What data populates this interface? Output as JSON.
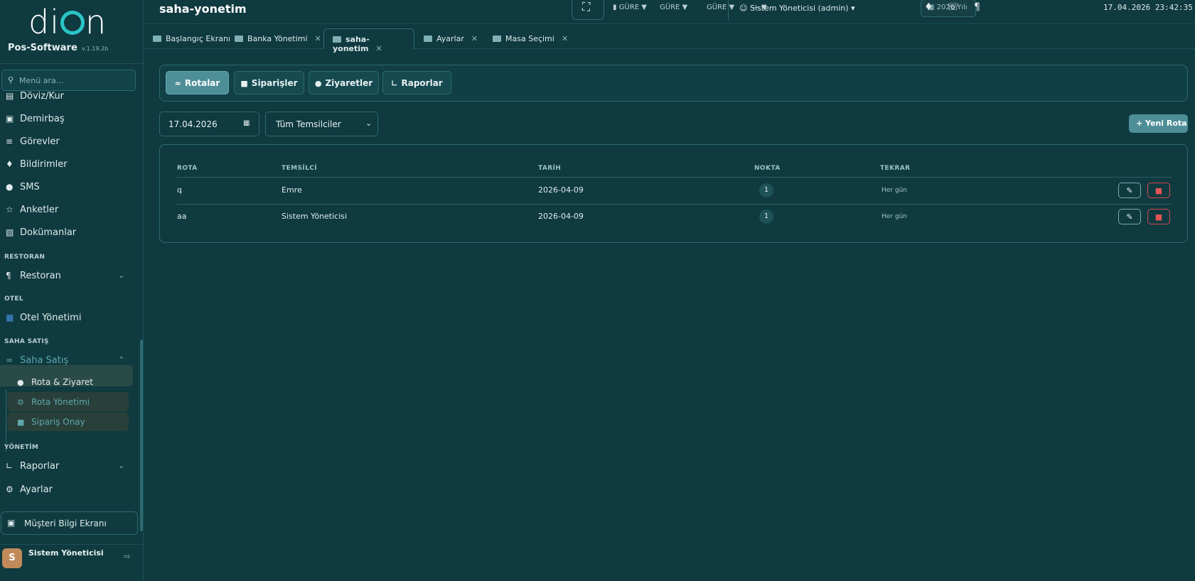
{
  "brand": {
    "logo_text_left": "di",
    "logo_text_right": "n",
    "product": "Pos-Software",
    "version": "v.1.19.2b"
  },
  "sidebar": {
    "search_placeholder": "Menü ara...",
    "items": [
      {
        "label": "Döviz/Kur",
        "icon": "money-icon"
      },
      {
        "label": "Demirbaş",
        "icon": "monitor-icon"
      },
      {
        "label": "Görevler",
        "icon": "tasks-icon"
      },
      {
        "label": "Bildirimler",
        "icon": "bell-icon"
      },
      {
        "label": "SMS",
        "icon": "chat-icon"
      },
      {
        "label": "Anketler",
        "icon": "star-icon"
      },
      {
        "label": "Dokümanlar",
        "icon": "folder-icon"
      }
    ],
    "section_restoran": "RESTORAN",
    "restoran": "Restoran",
    "section_otel": "OTEL",
    "otel": "Otel Yönetimi",
    "section_saha": "SAHA SATIŞ",
    "saha": "Saha Satış",
    "saha_sub": [
      "Rota & Ziyaret",
      "Rota Yönetimi",
      "Sipariş Onay"
    ],
    "section_yonetim": "YÖNETİM",
    "raporlar": "Raporlar",
    "ayarlar": "Ayarlar",
    "musteri": "Müşteri Bilgi Ekranı",
    "user_initial": "S",
    "user_name": "Sistem Yöneticisi"
  },
  "topbar": {
    "title": "saha-yonetim",
    "gure1": "GÜRE",
    "gure2": "GÜRE",
    "gure3": "GÜRE",
    "dash": "—",
    "user": "Sistem Yöneticisi (admin)",
    "year": "2026 Yılı",
    "datetime": "17.04.2026 23:42:35"
  },
  "tabs": [
    {
      "label": "Başlangıç Ekranı"
    },
    {
      "label": "Banka Yönetimi"
    },
    {
      "label": "saha-yonetim"
    },
    {
      "label": "Ayarlar"
    },
    {
      "label": "Masa Seçimi"
    }
  ],
  "subnav": [
    "Rotalar",
    "Siparişler",
    "Ziyaretler",
    "Raporlar"
  ],
  "filters": {
    "date": "17.04.2026",
    "rep": "Tüm Temsilciler"
  },
  "new_button": "Yeni Rota",
  "table": {
    "headers": [
      "ROTA",
      "TEMSİLCİ",
      "TARİH",
      "NOKTA",
      "TEKRAR"
    ],
    "rows": [
      {
        "rota": "q",
        "temsilci": "Emre",
        "tarih": "2026-04-09",
        "nokta": "1",
        "tekrar": "Her gün"
      },
      {
        "rota": "aa",
        "temsilci": "Sistem Yöneticisi",
        "tarih": "2026-04-09",
        "nokta": "1",
        "tekrar": "Her gün"
      }
    ]
  },
  "colors": {
    "accent": "#4d8e97",
    "background": "#0e3a40",
    "danger": "#d94b4b",
    "brand_ring": "#2bc4c6"
  }
}
